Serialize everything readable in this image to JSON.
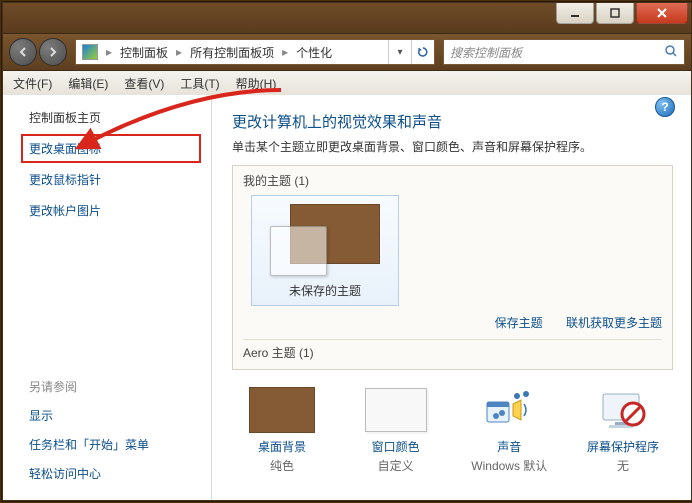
{
  "window": {
    "min_tip": "Minimize",
    "max_tip": "Maximize",
    "close_tip": "Close"
  },
  "nav": {
    "crumb1": "控制面板",
    "crumb2": "所有控制面板项",
    "crumb3": "个性化",
    "search_placeholder": "搜索控制面板"
  },
  "menu": {
    "file": "文件(F)",
    "edit": "编辑(E)",
    "view": "查看(V)",
    "tools": "工具(T)",
    "help": "帮助(H)"
  },
  "sidebar": {
    "home": "控制面板主页",
    "l1": "更改桌面图标",
    "l2": "更改鼠标指针",
    "l3": "更改帐户图片",
    "see_also": "另请参阅",
    "b1": "显示",
    "b2": "任务栏和「开始」菜单",
    "b3": "轻松访问中心"
  },
  "main": {
    "title": "更改计算机上的视觉效果和声音",
    "subtitle": "单击某个主题立即更改桌面背景、窗口颜色、声音和屏幕保护程序。",
    "my_themes": "我的主题 (1)",
    "theme0_name": "未保存的主题",
    "save_theme": "保存主题",
    "get_more": "联机获取更多主题",
    "aero_heading": "Aero 主题 (1)"
  },
  "quick": {
    "i1_label": "桌面背景",
    "i1_sub": "纯色",
    "i2_label": "窗口颜色",
    "i2_sub": "自定义",
    "i3_label": "声音",
    "i3_sub": "Windows 默认",
    "i4_label": "屏幕保护程序",
    "i4_sub": "无"
  }
}
